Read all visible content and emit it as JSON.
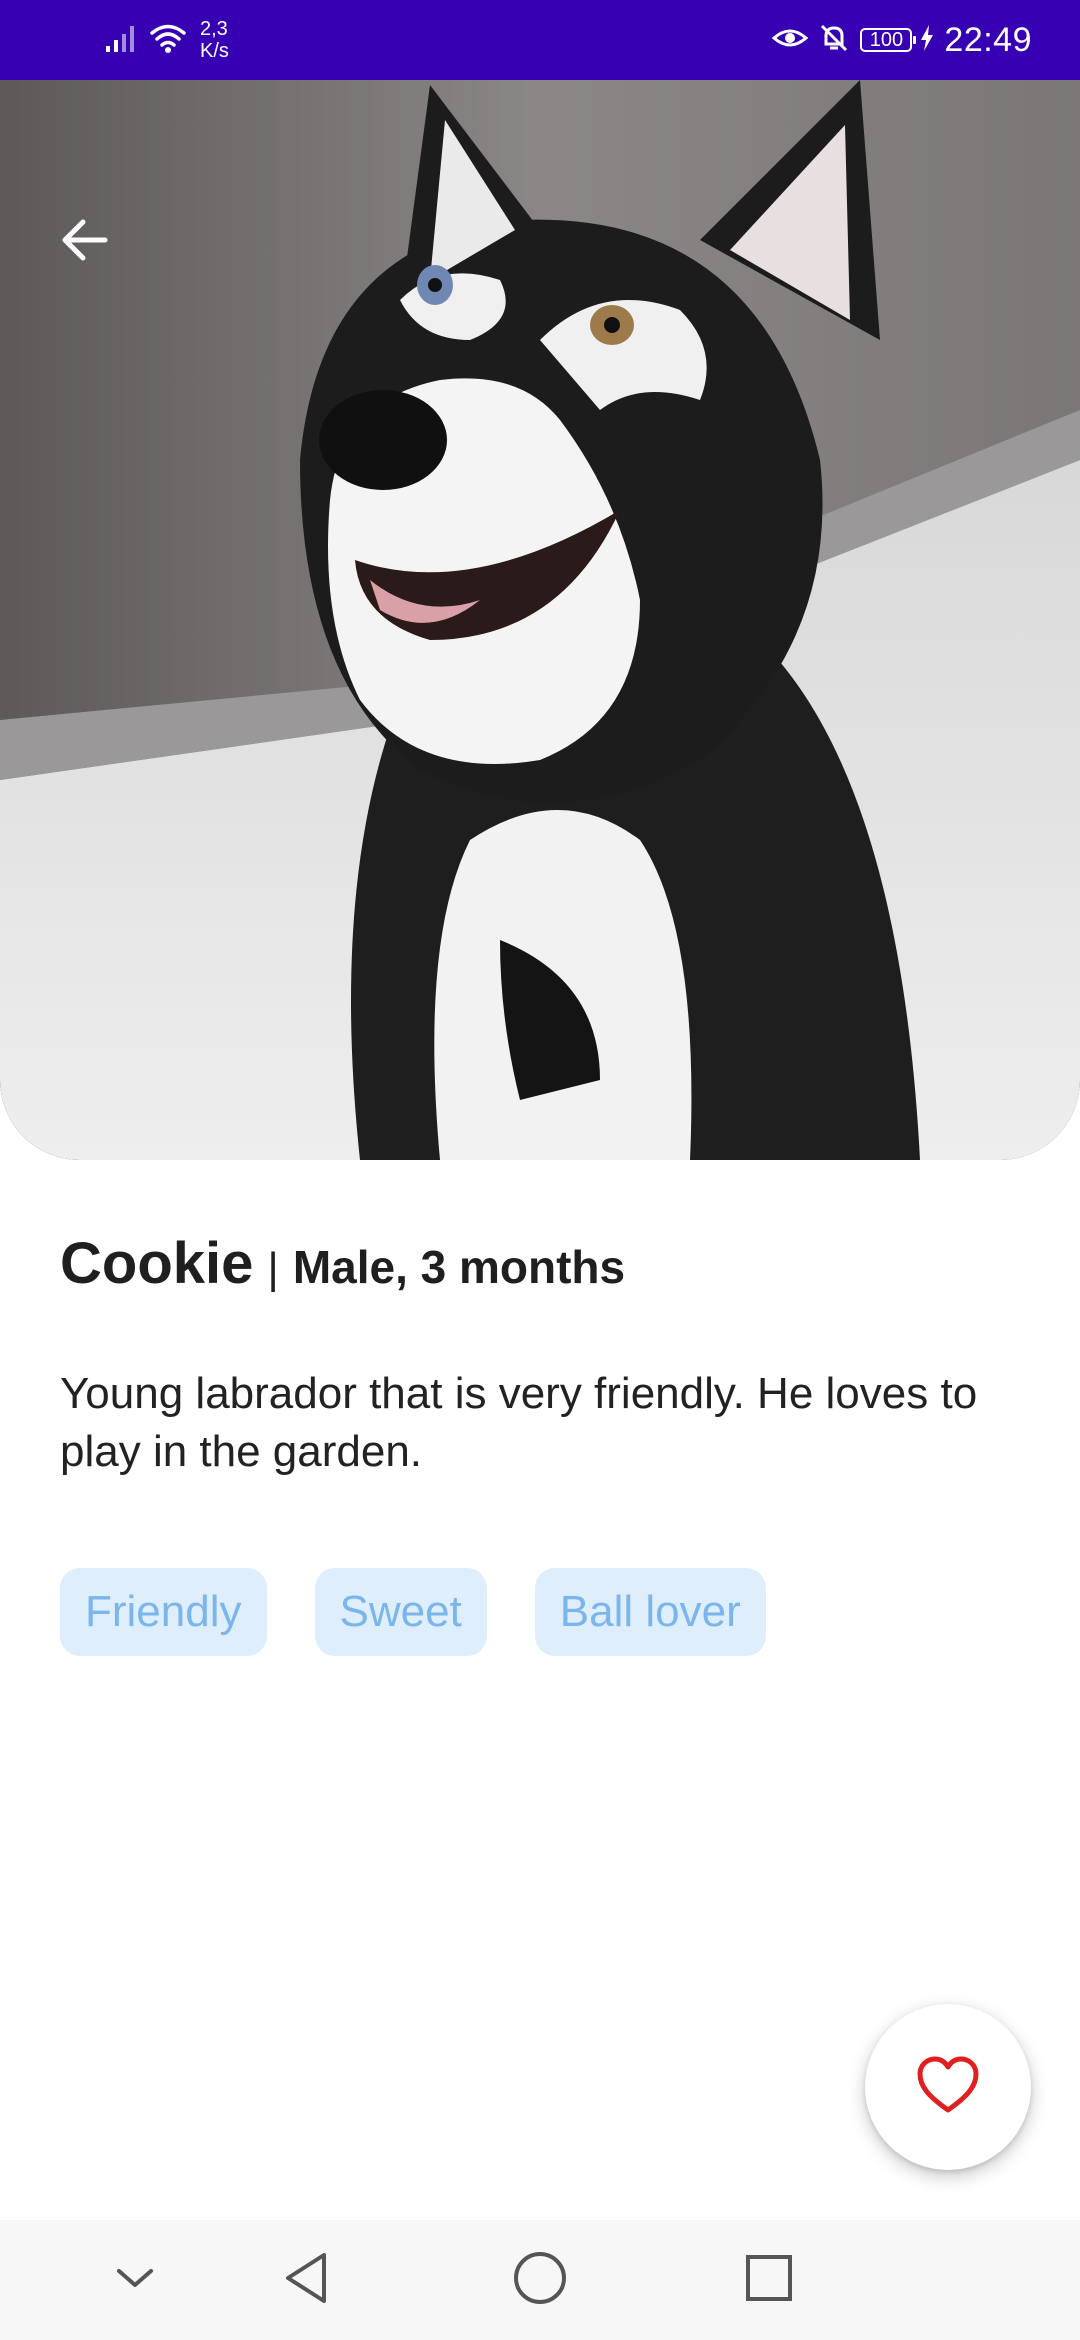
{
  "status_bar": {
    "network_speed_value": "2,3",
    "network_speed_unit": "K/s",
    "battery_level": "100",
    "time": "22:49",
    "icons": [
      "signal-icon",
      "wifi-icon",
      "eye-comfort-icon",
      "mute-bell-icon",
      "battery-icon",
      "charging-bolt-icon"
    ]
  },
  "hero": {
    "back_icon": "arrow-left-icon"
  },
  "pet": {
    "name": "Cookie",
    "separator": "|",
    "meta": "Male, 3 months",
    "description": "Young labrador that is very friendly. He loves to play in the garden.",
    "tags": [
      "Friendly",
      "Sweet",
      "Ball lover"
    ]
  },
  "fab": {
    "icon": "heart-outline-icon",
    "color": "#e02020"
  },
  "nav_bar": {
    "buttons": [
      "hide-nav-icon",
      "back-triangle-icon",
      "home-circle-icon",
      "recents-square-icon"
    ]
  },
  "colors": {
    "status_bar": "#3700b3",
    "tag_background": "#dfeefd",
    "tag_text": "#7ab6ec",
    "text_primary": "#1f1f1f"
  }
}
